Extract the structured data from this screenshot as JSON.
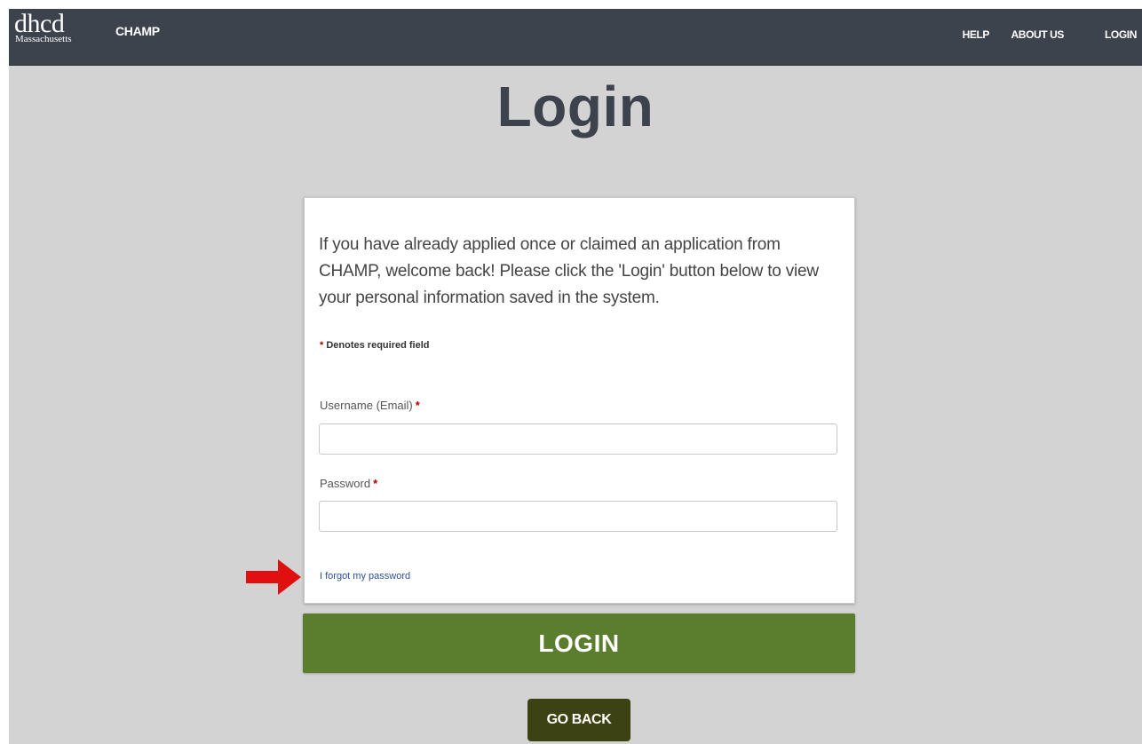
{
  "navbar": {
    "logo": {
      "main": "dhcd",
      "sub": "Massachusetts"
    },
    "brand": "CHAMP",
    "links": [
      "HELP",
      "ABOUT US",
      "LOGIN"
    ]
  },
  "page": {
    "title": "Login"
  },
  "card": {
    "intro": "If you have already applied once or claimed an application from CHAMP, welcome back! Please click the 'Login' button below to view your personal information saved in the system.",
    "required_note": "Denotes required field",
    "required_marker": "*",
    "username": {
      "label": "Username (Email)",
      "value": "",
      "placeholder": ""
    },
    "password": {
      "label": "Password",
      "value": "",
      "placeholder": ""
    },
    "forgot_link": "I forgot my password"
  },
  "actions": {
    "login": "LOGIN",
    "go_back": "GO BACK"
  },
  "colors": {
    "navbar_bg": "#3d434d",
    "page_bg": "#d3d3d3",
    "login_button": "#5b7e2e",
    "go_back_button": "#3c4212",
    "required_star": "#b00000",
    "link": "#2b4fa0",
    "annotation_arrow": "#e01010"
  },
  "icons": {
    "annotation": "red-arrow-icon"
  }
}
